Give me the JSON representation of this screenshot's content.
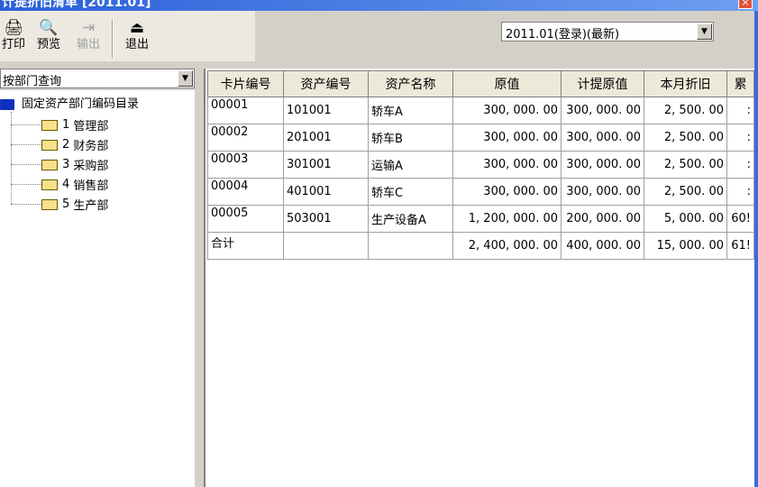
{
  "window": {
    "title": "计提折旧清单 [2011.01]",
    "close_glyph": "×"
  },
  "toolbar": {
    "buttons": [
      {
        "label": "打印",
        "icon": "🖨",
        "enabled": true
      },
      {
        "label": "预览",
        "icon": "🔍",
        "enabled": true
      },
      {
        "label": "输出",
        "icon": "⇥",
        "enabled": false
      },
      {
        "label": "退出",
        "icon": "⏏",
        "enabled": true
      }
    ]
  },
  "period_select": {
    "value": "2011.01(登录)(最新)",
    "arrow": "▼"
  },
  "query_select": {
    "value": "按部门查询",
    "arrow": "▼"
  },
  "tree": {
    "root": "固定资产部门编码目录",
    "items": [
      {
        "code": "1",
        "name": "管理部"
      },
      {
        "code": "2",
        "name": "财务部"
      },
      {
        "code": "3",
        "name": "采购部"
      },
      {
        "code": "4",
        "name": "销售部"
      },
      {
        "code": "5",
        "name": "生产部"
      }
    ]
  },
  "grid": {
    "columns": [
      "卡片编号",
      "资产编号",
      "资产名称",
      "原值",
      "计提原值",
      "本月折旧",
      "累"
    ],
    "rows": [
      [
        "00001",
        "101001",
        "轿车A",
        "300, 000. 00",
        "300, 000. 00",
        "2, 500. 00",
        ":"
      ],
      [
        "00002",
        "201001",
        "轿车B",
        "300, 000. 00",
        "300, 000. 00",
        "2, 500. 00",
        ":"
      ],
      [
        "00003",
        "301001",
        "运输A",
        "300, 000. 00",
        "300, 000. 00",
        "2, 500. 00",
        ":"
      ],
      [
        "00004",
        "401001",
        "轿车C",
        "300, 000. 00",
        "300, 000. 00",
        "2, 500. 00",
        ":"
      ],
      [
        "00005",
        "503001",
        "生产设备A",
        "1, 200, 000. 00",
        "200, 000. 00",
        "5, 000. 00",
        "60!"
      ],
      [
        "合计",
        "",
        "",
        "2, 400, 000. 00",
        "400, 000. 00",
        "15, 000. 00",
        "61!"
      ]
    ]
  }
}
